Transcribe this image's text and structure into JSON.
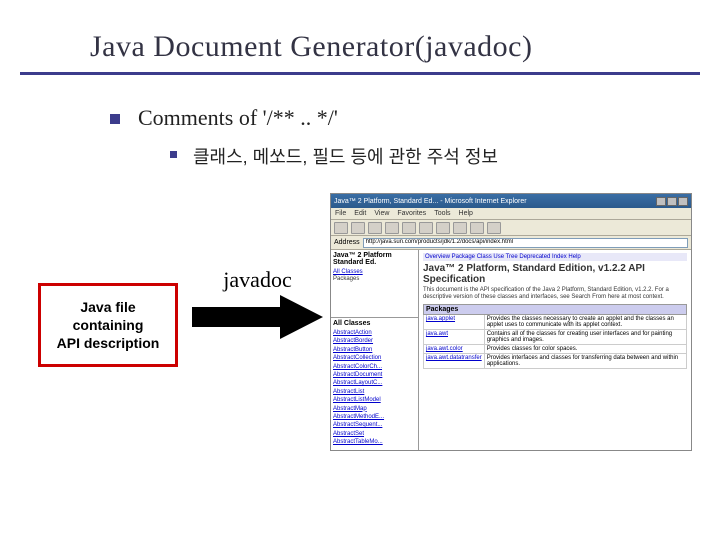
{
  "title": "Java Document Generator(javadoc)",
  "bullet": "Comments of '/** .. */'",
  "sub_bullet": "클래스, 메쏘드, 필드 등에 관한 주석 정보",
  "red_box": {
    "line1": "Java file",
    "line2": "containing",
    "line3": "API description"
  },
  "arrow_label": "javadoc",
  "browser": {
    "window_title": "Java™ 2 Platform, Standard Ed... - Microsoft Internet Explorer",
    "menu": [
      "File",
      "Edit",
      "View",
      "Favorites",
      "Tools",
      "Help"
    ],
    "addr_label": "Address",
    "addr_url": "http://java.sun.com/products/jdk/1.2/docs/api/index.html"
  },
  "javadoc": {
    "left_top_title": "Java™ 2 Platform\nStandard Ed.",
    "left_top_link": "All Classes",
    "left_top_sub": "Packages",
    "left_bottom_title": "All Classes",
    "classes": [
      "AbstractAction",
      "AbstractBorder",
      "AbstractButton",
      "AbstractCollection",
      "AbstractColorCh...",
      "AbstractDocument",
      "AbstractLayoutC...",
      "AbstractList",
      "AbstractListModel",
      "AbstractMap",
      "AbstractMethodE...",
      "AbstractSequent...",
      "AbstractSet",
      "AbstractTableMo..."
    ],
    "nav": "Overview Package Class Use Tree Deprecated Index Help",
    "main_title": "Java™ 2 Platform, Standard Edition, v1.2.2\nAPI Specification",
    "main_desc": "This document is the API specification of the Java 2 Platform, Standard Edition, v1.2.2. For a descriptive version of these classes and interfaces, see Search From here at most context.",
    "pkg_header": "Packages",
    "packages": [
      {
        "name": "java.applet",
        "desc": "Provides the classes necessary to create an applet and the classes an applet uses to communicate with its applet context."
      },
      {
        "name": "java.awt",
        "desc": "Contains all of the classes for creating user interfaces and for painting graphics and images."
      },
      {
        "name": "java.awt.color",
        "desc": "Provides classes for color spaces."
      },
      {
        "name": "java.awt.datatransfer",
        "desc": "Provides interfaces and classes for transferring data between and within applications."
      }
    ]
  }
}
